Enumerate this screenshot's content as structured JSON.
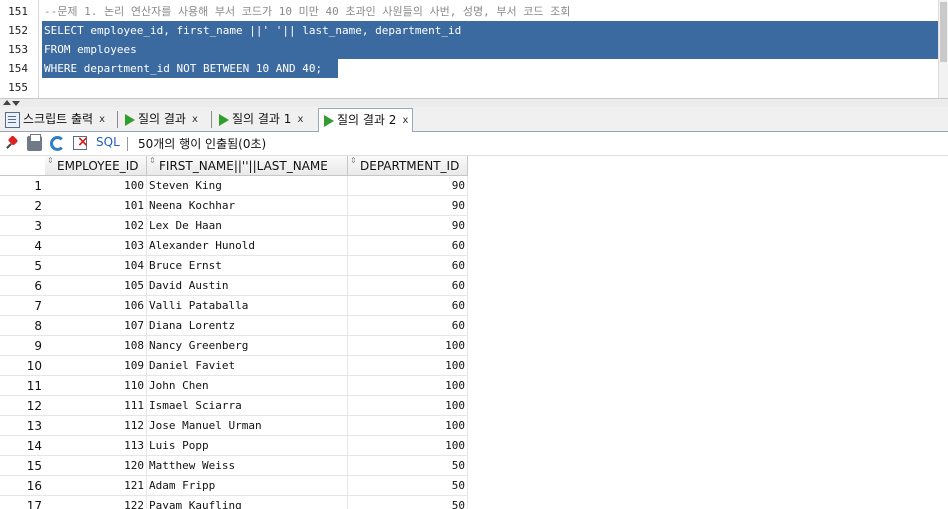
{
  "editor": {
    "lines": [
      {
        "num": "151",
        "text": "--문제 1. 논리 연산자를 사용해 부서 코드가 10 미만 40 초과인 사원들의 사번, 성명, 부서 코드 조회"
      },
      {
        "num": "152",
        "text": "SELECT employee_id, first_name ||' '|| last_name, department_id"
      },
      {
        "num": "153",
        "text": "FROM employees"
      },
      {
        "num": "154",
        "text": "WHERE department_id NOT BETWEEN 10 AND 40;"
      },
      {
        "num": "155",
        "text": ""
      }
    ]
  },
  "tabs": [
    {
      "label": "스크립트 출력",
      "close": "x",
      "icon": "script-output-icon"
    },
    {
      "label": "질의 결과",
      "close": "x",
      "icon": "run-query-icon"
    },
    {
      "label": "질의 결과 1",
      "close": "x",
      "icon": "run-query-icon"
    },
    {
      "label": "질의 결과 2",
      "close": "x",
      "icon": "run-query-icon",
      "active": true
    }
  ],
  "toolbar": {
    "sql_label": "SQL",
    "status": "50개의 행이 인출됨(0초)"
  },
  "grid": {
    "columns": [
      "EMPLOYEE_ID",
      "FIRST_NAME||''||LAST_NAME",
      "DEPARTMENT_ID"
    ],
    "rows": [
      {
        "n": "1",
        "id": "100",
        "name": "Steven King",
        "dept": "90"
      },
      {
        "n": "2",
        "id": "101",
        "name": "Neena Kochhar",
        "dept": "90"
      },
      {
        "n": "3",
        "id": "102",
        "name": "Lex De Haan",
        "dept": "90"
      },
      {
        "n": "4",
        "id": "103",
        "name": "Alexander Hunold",
        "dept": "60"
      },
      {
        "n": "5",
        "id": "104",
        "name": "Bruce Ernst",
        "dept": "60"
      },
      {
        "n": "6",
        "id": "105",
        "name": "David Austin",
        "dept": "60"
      },
      {
        "n": "7",
        "id": "106",
        "name": "Valli Pataballa",
        "dept": "60"
      },
      {
        "n": "8",
        "id": "107",
        "name": "Diana Lorentz",
        "dept": "60"
      },
      {
        "n": "9",
        "id": "108",
        "name": "Nancy Greenberg",
        "dept": "100"
      },
      {
        "n": "10",
        "id": "109",
        "name": "Daniel Faviet",
        "dept": "100"
      },
      {
        "n": "11",
        "id": "110",
        "name": "John Chen",
        "dept": "100"
      },
      {
        "n": "12",
        "id": "111",
        "name": "Ismael Sciarra",
        "dept": "100"
      },
      {
        "n": "13",
        "id": "112",
        "name": "Jose Manuel Urman",
        "dept": "100"
      },
      {
        "n": "14",
        "id": "113",
        "name": "Luis Popp",
        "dept": "100"
      },
      {
        "n": "15",
        "id": "120",
        "name": "Matthew Weiss",
        "dept": "50"
      },
      {
        "n": "16",
        "id": "121",
        "name": "Adam Fripp",
        "dept": "50"
      },
      {
        "n": "17",
        "id": "122",
        "name": "Payam Kaufling",
        "dept": "50"
      }
    ]
  }
}
